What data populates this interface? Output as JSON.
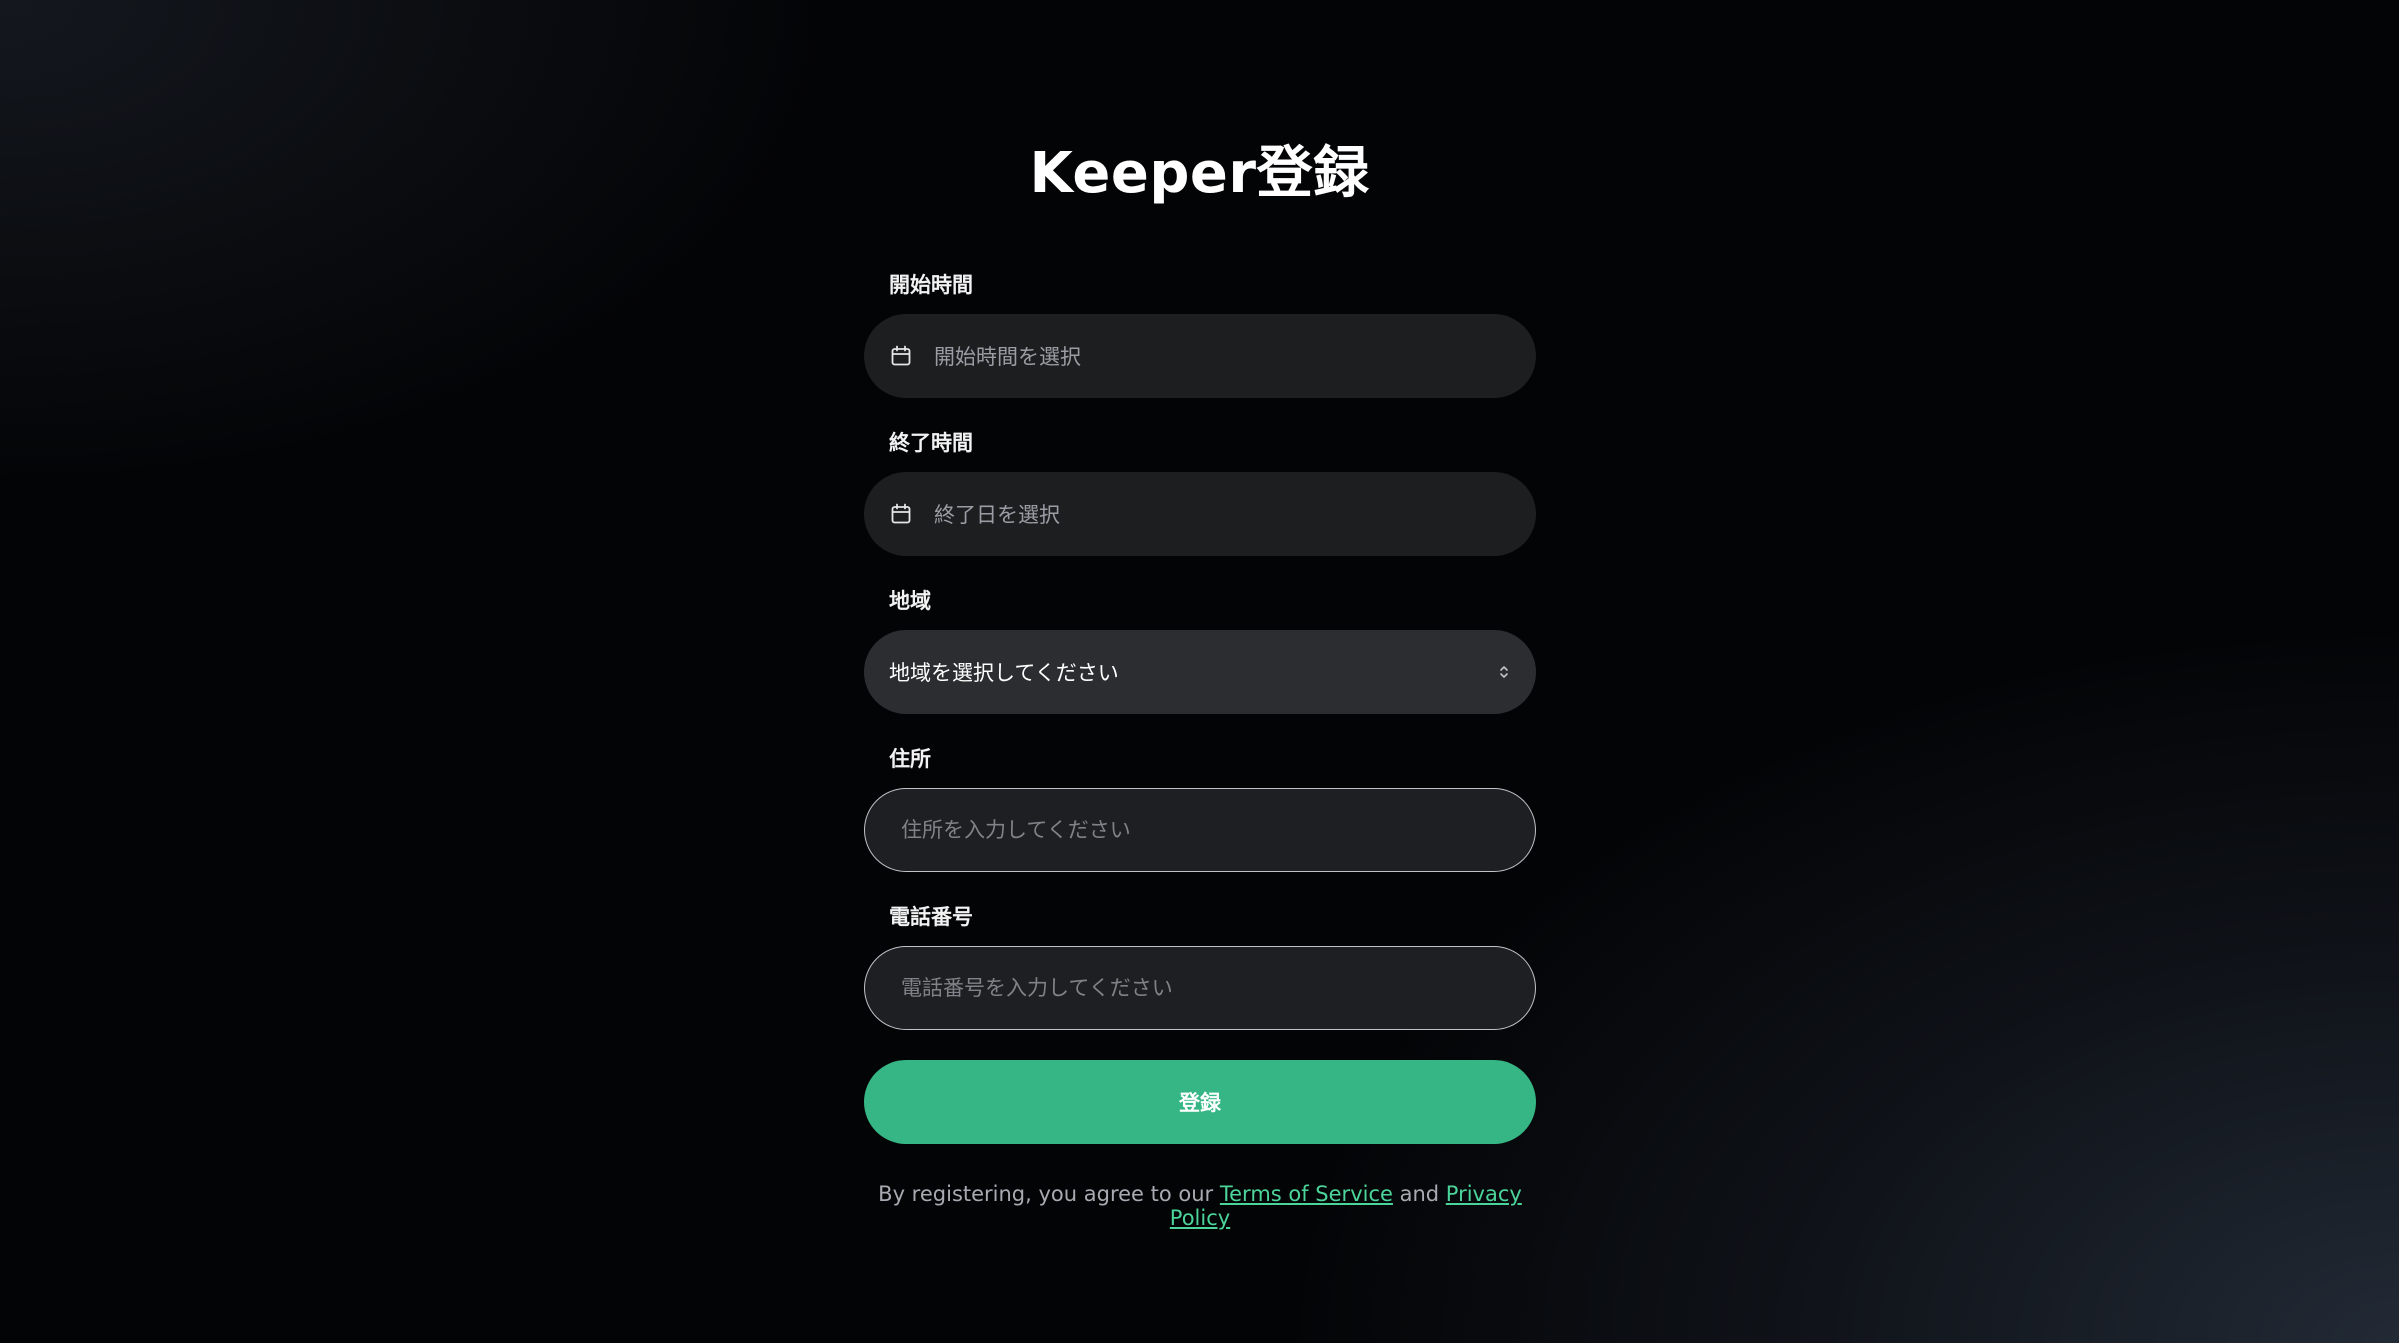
{
  "page": {
    "title": "Keeper登録"
  },
  "form": {
    "start_time": {
      "label": "開始時間",
      "placeholder": "開始時間を選択",
      "icon": "calendar-icon"
    },
    "end_time": {
      "label": "終了時間",
      "placeholder": "終了日を選択",
      "icon": "calendar-icon"
    },
    "region": {
      "label": "地域",
      "selected": "地域を選択してください",
      "icon": "chevron-updown-icon"
    },
    "address": {
      "label": "住所",
      "value": "",
      "placeholder": "住所を入力してください"
    },
    "phone": {
      "label": "電話番号",
      "value": "",
      "placeholder": "電話番号を入力してください"
    },
    "submit_label": "登録"
  },
  "legal": {
    "prefix": "By registering, you agree to our ",
    "terms_link": "Terms of Service",
    "conjunction": " and ",
    "privacy_link": "Privacy Policy"
  },
  "colors": {
    "accent": "#36b684",
    "link": "#4cd59a",
    "background": "#030406"
  }
}
